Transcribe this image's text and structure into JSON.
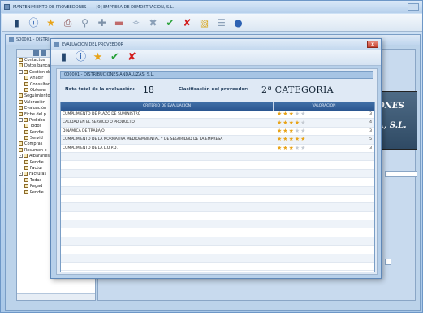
{
  "main": {
    "title": "MANTENIMIENTO DE PROVEEDORES",
    "subtitle": "[0] EMPRESA DE DEMOSTRACION, S.L."
  },
  "child": {
    "title": "S00001 - DISTRI"
  },
  "tree": {
    "items": [
      {
        "label": "Contactos",
        "indent": 0,
        "pm": false
      },
      {
        "label": "Datos bancarios",
        "indent": 0,
        "pm": false
      },
      {
        "label": "Gestion de",
        "indent": 0,
        "pm": true
      },
      {
        "label": "Añadir",
        "indent": 1,
        "pm": false
      },
      {
        "label": "Consultar",
        "indent": 1,
        "pm": false
      },
      {
        "label": "Obtener",
        "indent": 1,
        "pm": false
      },
      {
        "label": "Seguimiento",
        "indent": 0,
        "pm": false
      },
      {
        "label": "Valoración",
        "indent": 0,
        "pm": false
      },
      {
        "label": "Evaluación",
        "indent": 0,
        "pm": false
      },
      {
        "label": "Fiche del p",
        "indent": 0,
        "pm": false
      },
      {
        "label": "Pedidos",
        "indent": 0,
        "pm": true
      },
      {
        "label": "Todos",
        "indent": 1,
        "pm": false
      },
      {
        "label": "Pendie",
        "indent": 1,
        "pm": false
      },
      {
        "label": "Servid",
        "indent": 1,
        "pm": false
      },
      {
        "label": "Compras",
        "indent": 0,
        "pm": false
      },
      {
        "label": "Resumen c",
        "indent": 0,
        "pm": false
      },
      {
        "label": "Albaranes",
        "indent": 0,
        "pm": true
      },
      {
        "label": "Pendie",
        "indent": 1,
        "pm": false
      },
      {
        "label": "Factur",
        "indent": 1,
        "pm": false
      },
      {
        "label": "Facturas",
        "indent": 0,
        "pm": true
      },
      {
        "label": "Todas",
        "indent": 1,
        "pm": false
      },
      {
        "label": "Pagad",
        "indent": 1,
        "pm": false
      },
      {
        "label": "Pendie",
        "indent": 1,
        "pm": false
      }
    ]
  },
  "logo": {
    "line1": "ONES",
    "line2": "A, S.L."
  },
  "dialog": {
    "title": "EVALUACION DEL PROVEEDOR",
    "close_label": "x",
    "provider": "000001 - DISTRIBUCIONES ANDALUZAS, S.L.",
    "note_label": "Nota total de la evaluación:",
    "note_value": "18",
    "class_label": "Clasificación del proveedor:",
    "class_value": "2ª CATEGORIA",
    "columns": {
      "criterio": "CRITERIO DE EVALUACION",
      "valoracion": "VALORACION"
    },
    "rows": [
      {
        "criterio": "CUMPLIMIENTO DE PLAZO DE SUMINISTRO",
        "stars": 3,
        "score": "3"
      },
      {
        "criterio": "CALIDAD EN EL SERVICIO O PRODUCTO",
        "stars": 4,
        "score": "4"
      },
      {
        "criterio": "DINAMICA DE TRABAJO",
        "stars": 3,
        "score": "3"
      },
      {
        "criterio": "CUMPLIMIENTO DE LA NORMATIVA MEDIOAMBIENTAL Y DE SEGURIDAD DE LA EMPRESA",
        "stars": 5,
        "score": "5"
      },
      {
        "criterio": "CUMPLIMIENTO DE LA L.O.P.D.",
        "stars": 3,
        "score": "3"
      }
    ],
    "empty_rows": 14
  },
  "icons": {
    "main_toolbar": [
      "app-icon",
      "info-icon",
      "star-icon",
      "print-icon",
      "search-icon",
      "add-icon",
      "remove-icon",
      "filter-icon",
      "clear-icon",
      "check-icon",
      "cancel-icon",
      "folder-icon",
      "list-icon",
      "globe-icon"
    ],
    "dialog_toolbar": [
      "app-icon",
      "info-icon",
      "star-icon",
      "check-icon",
      "cancel-icon"
    ]
  },
  "colors": {
    "star_on": "#e8a317",
    "header_bg": "#2b5690",
    "check": "#27a137",
    "cancel": "#d21f1f"
  }
}
